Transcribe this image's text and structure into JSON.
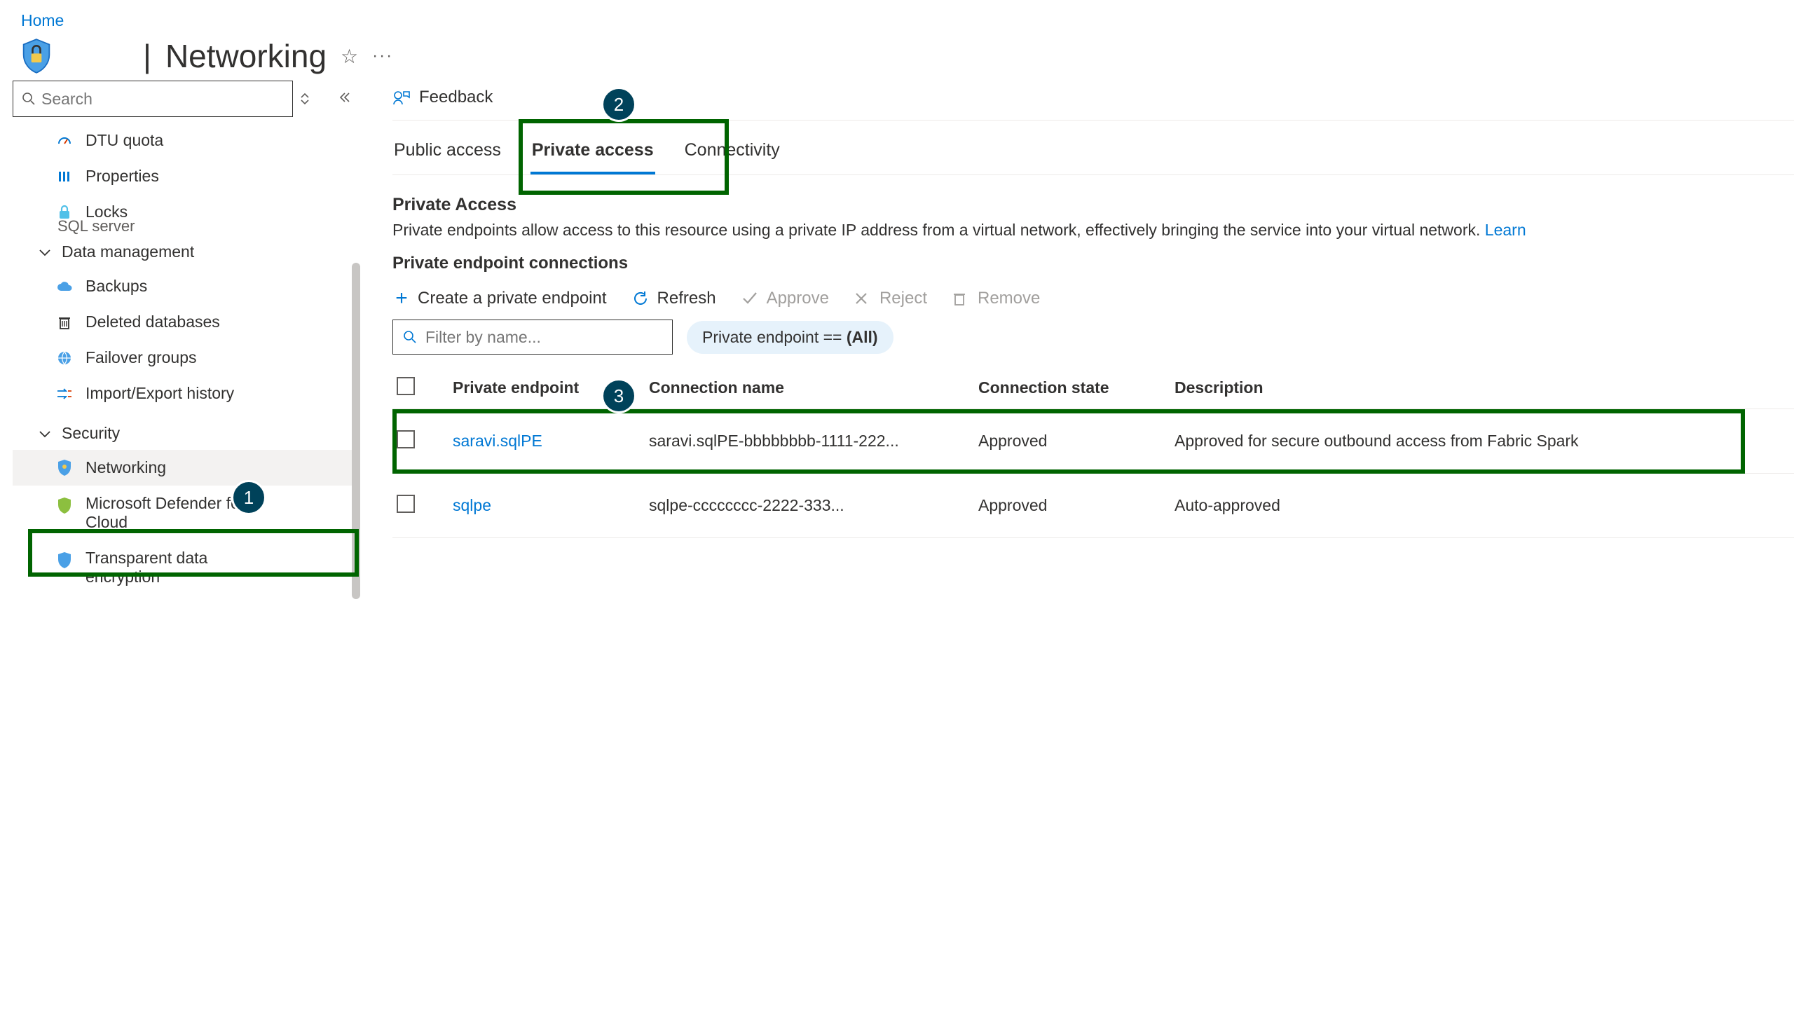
{
  "breadcrumb": {
    "home": "Home"
  },
  "header": {
    "separator": "|",
    "title": "Networking",
    "resource_type": "SQL server"
  },
  "sidebar": {
    "search_placeholder": "Search",
    "items": [
      {
        "label": "DTU quota"
      },
      {
        "label": "Properties"
      },
      {
        "label": "Locks"
      }
    ],
    "section_data": "Data management",
    "data_items": [
      {
        "label": "Backups"
      },
      {
        "label": "Deleted databases"
      },
      {
        "label": "Failover groups"
      },
      {
        "label": "Import/Export history"
      }
    ],
    "section_security": "Security",
    "security_items": [
      {
        "label": "Networking"
      },
      {
        "label": "Microsoft Defender for Cloud"
      },
      {
        "label": "Transparent data encryption"
      }
    ]
  },
  "main": {
    "feedback": "Feedback",
    "tabs": {
      "public": "Public access",
      "private": "Private access",
      "connectivity": "Connectivity"
    },
    "section_title": "Private Access",
    "section_desc": "Private endpoints allow access to this resource using a private IP address from a virtual network, effectively bringing the service into your virtual network.",
    "learn": "Learn",
    "subheader": "Private endpoint connections",
    "actions": {
      "create": "Create a private endpoint",
      "refresh": "Refresh",
      "approve": "Approve",
      "reject": "Reject",
      "remove": "Remove"
    },
    "filter_placeholder": "Filter by name...",
    "pill_prefix": "Private endpoint == ",
    "pill_value": "(All)",
    "columns": {
      "pe": "Private endpoint",
      "conn": "Connection name",
      "state": "Connection state",
      "desc": "Description"
    },
    "rows": [
      {
        "pe": "saravi.sqlPE",
        "conn": "saravi.sqlPE-bbbbbbbb-1111-222...",
        "state": "Approved",
        "desc": "Approved for secure outbound access from Fabric Spark"
      },
      {
        "pe": "sqlpe",
        "conn": "sqlpe-cccccccc-2222-333...",
        "state": "Approved",
        "desc": "Auto-approved"
      }
    ]
  },
  "annotations": {
    "b1": "1",
    "b2": "2",
    "b3": "3"
  }
}
